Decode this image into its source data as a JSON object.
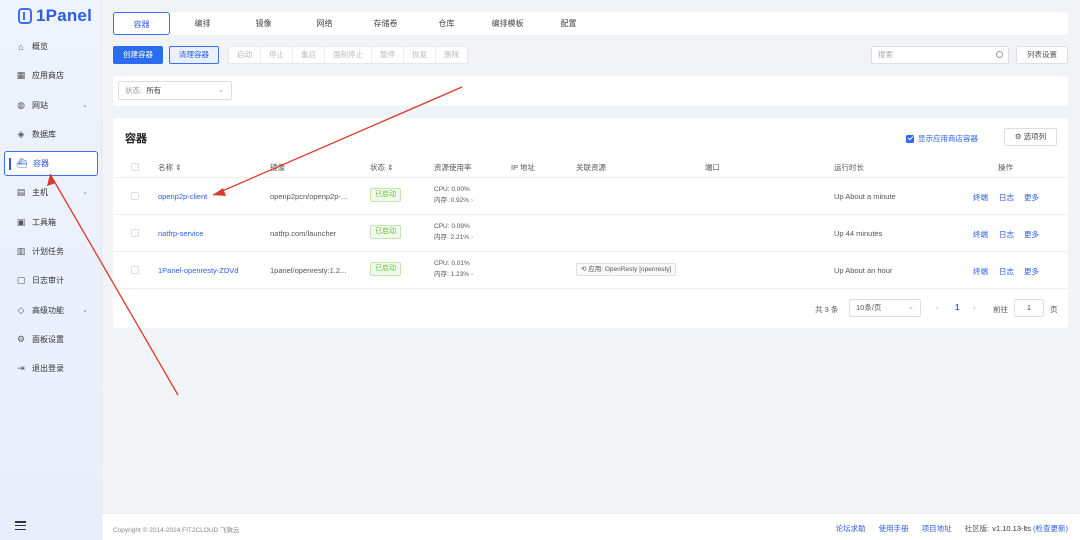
{
  "app": {
    "name": "1Panel"
  },
  "sidebar": {
    "items": [
      {
        "label": "概览",
        "icon": "home-icon",
        "has_chevron": false
      },
      {
        "label": "应用商店",
        "icon": "grid-icon",
        "has_chevron": false
      },
      {
        "label": "网站",
        "icon": "globe-icon",
        "has_chevron": true
      },
      {
        "label": "数据库",
        "icon": "layers-icon",
        "has_chevron": false
      },
      {
        "label": "容器",
        "icon": "container-icon",
        "has_chevron": false,
        "active": true
      },
      {
        "label": "主机",
        "icon": "server-icon",
        "has_chevron": true
      },
      {
        "label": "工具箱",
        "icon": "toolbox-icon",
        "has_chevron": false
      },
      {
        "label": "计划任务",
        "icon": "calendar-icon",
        "has_chevron": false
      },
      {
        "label": "日志审计",
        "icon": "log-icon",
        "has_chevron": false
      },
      {
        "label": "高级功能",
        "icon": "diamond-icon",
        "has_chevron": true
      },
      {
        "label": "面板设置",
        "icon": "gear-icon",
        "has_chevron": false
      },
      {
        "label": "退出登录",
        "icon": "logout-icon",
        "has_chevron": false
      }
    ]
  },
  "tabs": [
    "容器",
    "编排",
    "镜像",
    "网络",
    "存储卷",
    "仓库",
    "编排模板",
    "配置"
  ],
  "toolbar": {
    "create": "创建容器",
    "clean": "清理容器",
    "group": [
      "启动",
      "停止",
      "重启",
      "强制停止",
      "暂停",
      "恢复",
      "删除"
    ],
    "search_placeholder": "搜索",
    "list_settings": "列表设置"
  },
  "filter": {
    "label": "状态:",
    "value": "所有"
  },
  "card": {
    "title": "容器",
    "show_app_containers": "显示应用商店容器",
    "columns_button": "选项列"
  },
  "table": {
    "headers": {
      "name": "名称",
      "image": "镜像",
      "status": "状态",
      "resource": "资源使用率",
      "ip": "IP 地址",
      "assoc": "关联资源",
      "port": "端口",
      "uptime": "运行时长",
      "actions": "操作"
    },
    "rows": [
      {
        "name": "openp2p-client",
        "image": "openp2pcn/openp2p-...",
        "status": "已启动",
        "cpu": "CPU: 0.00%",
        "mem": "内存: 0.92%",
        "assoc": "",
        "uptime": "Up About a minute"
      },
      {
        "name": "natfrp-service",
        "image": "natfrp.com/launcher",
        "status": "已启动",
        "cpu": "CPU: 0.09%",
        "mem": "内存: 2.21%",
        "assoc": "",
        "uptime": "Up 44 minutes"
      },
      {
        "name": "1Panel-openresty-ZDVd",
        "image": "1panel/openresty:1.2...",
        "status": "已启动",
        "cpu": "CPU: 0.01%",
        "mem": "内存: 1.23%",
        "assoc": "应用: OpenResty [openresty]",
        "uptime": "Up About an hour"
      }
    ],
    "ops": {
      "terminal": "终端",
      "log": "日志",
      "more": "更多"
    }
  },
  "pagination": {
    "total": "共 3 条",
    "page_size": "10条/页",
    "current": "1",
    "goto_label": "前往",
    "goto_value": "1",
    "page_unit": "页"
  },
  "footer": {
    "copyright": "Copyright © 2014-2024 FIT2CLOUD 飞致云",
    "forum": "论坛求助",
    "manual": "使用手册",
    "project": "项目地址",
    "edition_label": "社区版:",
    "version": "v1.10.13-lts",
    "check_update": "(检查更新)"
  },
  "colors": {
    "accent": "#2b6bef",
    "annotation": "#d93a2b",
    "running": "#67c23a"
  }
}
